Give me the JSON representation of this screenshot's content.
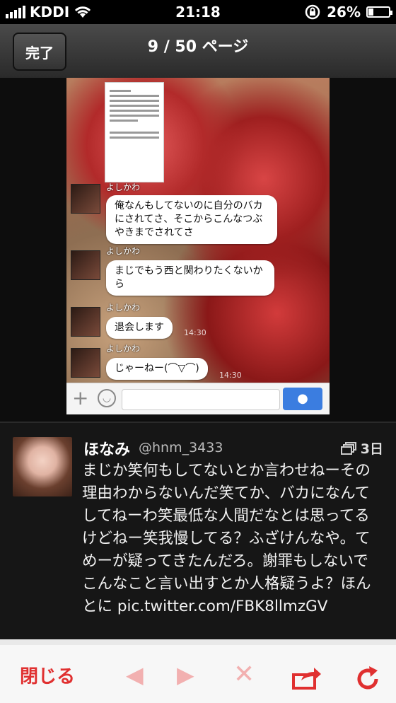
{
  "status_bar": {
    "carrier": "KDDI",
    "time": "21:18",
    "battery": "26%",
    "battery_level": 0.26
  },
  "nav": {
    "done_label": "完了",
    "title": "9 / 50 ページ"
  },
  "photo": {
    "messages": [
      {
        "sender": "よしかわ",
        "text": "俺なんもしてないのに自分のバカにされてさ、そこからこんなつぶやきまでされてさ",
        "time": ""
      },
      {
        "sender": "よしかわ",
        "text": "まじでもう西と関わりたくないから",
        "time": ""
      },
      {
        "sender": "よしかわ",
        "text": "退会します",
        "time": "14:30"
      },
      {
        "sender": "よしかわ",
        "text": "じゃーねー(⌒▽⌒)",
        "time": "14:30"
      }
    ]
  },
  "tweet": {
    "name": "ほなみ",
    "handle": "@hnm_3433",
    "age": "3日",
    "text": "まじか笑何もしてないとか言わせねーその理由わからないんだ笑てか、バカになんてしてねーわ笑最低な人間だなとは思ってるけどねー笑我慢してる？ふざけんなや。てめーが疑ってきたんだろ。謝罪もしないでこんなこと言い出すとか人格疑うよ？ほんとに pic.twitter.com/FBK8llmzGV"
  },
  "toolbar": {
    "close_label": "閉じる"
  },
  "colors": {
    "accent_red": "#e03030",
    "mic_blue": "#3b7de0"
  }
}
